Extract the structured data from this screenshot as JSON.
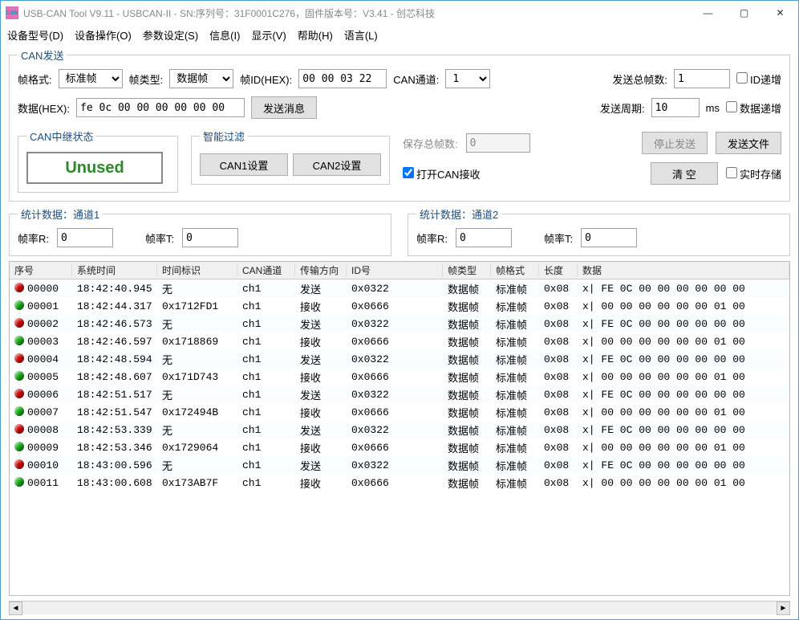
{
  "title": "USB-CAN Tool V9.11 - USBCAN-II - SN:序列号：31F0001C276，固件版本号：V3.41 - 创芯科技",
  "menu": [
    "设备型号(D)",
    "设备操作(O)",
    "参数设定(S)",
    "信息(I)",
    "显示(V)",
    "帮助(H)",
    "语言(L)"
  ],
  "send": {
    "legend": "CAN发送",
    "frame_fmt_label": "帧格式:",
    "frame_fmt": "标准帧",
    "frame_type_label": "帧类型:",
    "frame_type": "数据帧",
    "frame_id_label": "帧ID(HEX):",
    "frame_id": "00 00 03 22",
    "channel_label": "CAN通道:",
    "channel": "1",
    "total_label": "发送总帧数:",
    "total": "1",
    "id_inc_label": "ID递增",
    "data_label": "数据(HEX):",
    "data": "fe 0c 00 00 00 00 00 00",
    "send_btn": "发送消息",
    "period_label": "发送周期:",
    "period": "10",
    "period_unit": "ms",
    "data_inc_label": "数据递增"
  },
  "abort_group": {
    "legend": "CAN中继状态",
    "unused": "Unused"
  },
  "filter_group": {
    "legend": "智能过滤",
    "can1": "CAN1设置",
    "can2": "CAN2设置"
  },
  "save": {
    "save_total_label": "保存总帧数:",
    "save_total": "0",
    "open_recv_label": "打开CAN接收",
    "stop_btn": "停止发送",
    "sendfile_btn": "发送文件",
    "clear_btn": "清 空",
    "realtime_label": "实时存储"
  },
  "stats1": {
    "legend": "统计数据：通道1",
    "r_label": "帧率R:",
    "r": "0",
    "t_label": "帧率T:",
    "t": "0"
  },
  "stats2": {
    "legend": "统计数据：通道2",
    "r_label": "帧率R:",
    "r": "0",
    "t_label": "帧率T:",
    "t": "0"
  },
  "columns": [
    "序号",
    "系统时间",
    "时间标识",
    "CAN通道",
    "传输方向",
    "ID号",
    "帧类型",
    "帧格式",
    "长度",
    "数据"
  ],
  "rows": [
    {
      "dir_color": "red",
      "seq": "00000",
      "systime": "18:42:40.945",
      "timeid": "无",
      "chan": "ch1",
      "dir": "发送",
      "id": "0x0322",
      "ftype": "数据帧",
      "ffmt": "标准帧",
      "len": "0x08",
      "data": "x| FE 0C 00 00 00 00 00 00"
    },
    {
      "dir_color": "green",
      "seq": "00001",
      "systime": "18:42:44.317",
      "timeid": "0x1712FD1",
      "chan": "ch1",
      "dir": "接收",
      "id": "0x0666",
      "ftype": "数据帧",
      "ffmt": "标准帧",
      "len": "0x08",
      "data": "x| 00 00 00 00 00 00 01 00"
    },
    {
      "dir_color": "red",
      "seq": "00002",
      "systime": "18:42:46.573",
      "timeid": "无",
      "chan": "ch1",
      "dir": "发送",
      "id": "0x0322",
      "ftype": "数据帧",
      "ffmt": "标准帧",
      "len": "0x08",
      "data": "x| FE 0C 00 00 00 00 00 00"
    },
    {
      "dir_color": "green",
      "seq": "00003",
      "systime": "18:42:46.597",
      "timeid": "0x1718869",
      "chan": "ch1",
      "dir": "接收",
      "id": "0x0666",
      "ftype": "数据帧",
      "ffmt": "标准帧",
      "len": "0x08",
      "data": "x| 00 00 00 00 00 00 01 00"
    },
    {
      "dir_color": "red",
      "seq": "00004",
      "systime": "18:42:48.594",
      "timeid": "无",
      "chan": "ch1",
      "dir": "发送",
      "id": "0x0322",
      "ftype": "数据帧",
      "ffmt": "标准帧",
      "len": "0x08",
      "data": "x| FE 0C 00 00 00 00 00 00"
    },
    {
      "dir_color": "green",
      "seq": "00005",
      "systime": "18:42:48.607",
      "timeid": "0x171D743",
      "chan": "ch1",
      "dir": "接收",
      "id": "0x0666",
      "ftype": "数据帧",
      "ffmt": "标准帧",
      "len": "0x08",
      "data": "x| 00 00 00 00 00 00 01 00"
    },
    {
      "dir_color": "red",
      "seq": "00006",
      "systime": "18:42:51.517",
      "timeid": "无",
      "chan": "ch1",
      "dir": "发送",
      "id": "0x0322",
      "ftype": "数据帧",
      "ffmt": "标准帧",
      "len": "0x08",
      "data": "x| FE 0C 00 00 00 00 00 00"
    },
    {
      "dir_color": "green",
      "seq": "00007",
      "systime": "18:42:51.547",
      "timeid": "0x172494B",
      "chan": "ch1",
      "dir": "接收",
      "id": "0x0666",
      "ftype": "数据帧",
      "ffmt": "标准帧",
      "len": "0x08",
      "data": "x| 00 00 00 00 00 00 01 00"
    },
    {
      "dir_color": "red",
      "seq": "00008",
      "systime": "18:42:53.339",
      "timeid": "无",
      "chan": "ch1",
      "dir": "发送",
      "id": "0x0322",
      "ftype": "数据帧",
      "ffmt": "标准帧",
      "len": "0x08",
      "data": "x| FE 0C 00 00 00 00 00 00"
    },
    {
      "dir_color": "green",
      "seq": "00009",
      "systime": "18:42:53.346",
      "timeid": "0x1729064",
      "chan": "ch1",
      "dir": "接收",
      "id": "0x0666",
      "ftype": "数据帧",
      "ffmt": "标准帧",
      "len": "0x08",
      "data": "x| 00 00 00 00 00 00 01 00"
    },
    {
      "dir_color": "red",
      "seq": "00010",
      "systime": "18:43:00.596",
      "timeid": "无",
      "chan": "ch1",
      "dir": "发送",
      "id": "0x0322",
      "ftype": "数据帧",
      "ffmt": "标准帧",
      "len": "0x08",
      "data": "x| FE 0C 00 00 00 00 00 00"
    },
    {
      "dir_color": "green",
      "seq": "00011",
      "systime": "18:43:00.608",
      "timeid": "0x173AB7F",
      "chan": "ch1",
      "dir": "接收",
      "id": "0x0666",
      "ftype": "数据帧",
      "ffmt": "标准帧",
      "len": "0x08",
      "data": "x| 00 00 00 00 00 00 01 00"
    }
  ]
}
